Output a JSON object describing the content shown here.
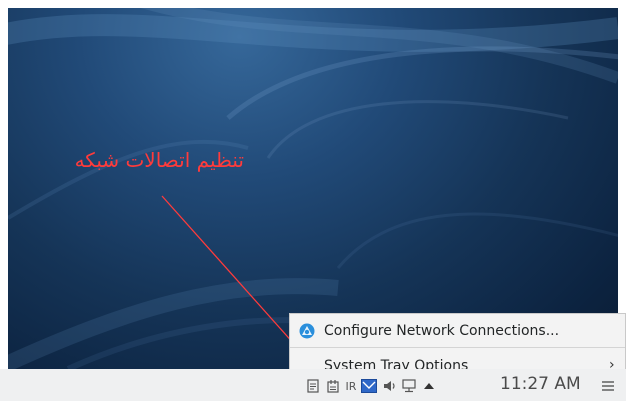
{
  "annotation": {
    "text": "تنظیم اتصالات شبکه",
    "color": "#ff3b3b"
  },
  "popup_menu": {
    "items": [
      {
        "label": "Configure Network Connections...",
        "icon": "network-icon"
      },
      {
        "label": "System Tray Options",
        "icon": "none",
        "submenu_arrow": "›"
      }
    ]
  },
  "taskbar": {
    "tray_icons": [
      "clipboard-icon",
      "notes-icon",
      "keyboard-layout-icon",
      "mail-icon",
      "volume-icon",
      "network-wired-icon",
      "expand-tray-arrow-icon",
      "hamburger-menu-icon"
    ],
    "keyboard_layout": "IR",
    "clock": "11:27 AM"
  },
  "colors": {
    "desktop_dark": "#0b1f38",
    "desktop_light": "#36689a",
    "taskbar_bg": "#eff0f1",
    "menu_bg": "#f3f3f3",
    "annotation": "#ff3b3b"
  }
}
